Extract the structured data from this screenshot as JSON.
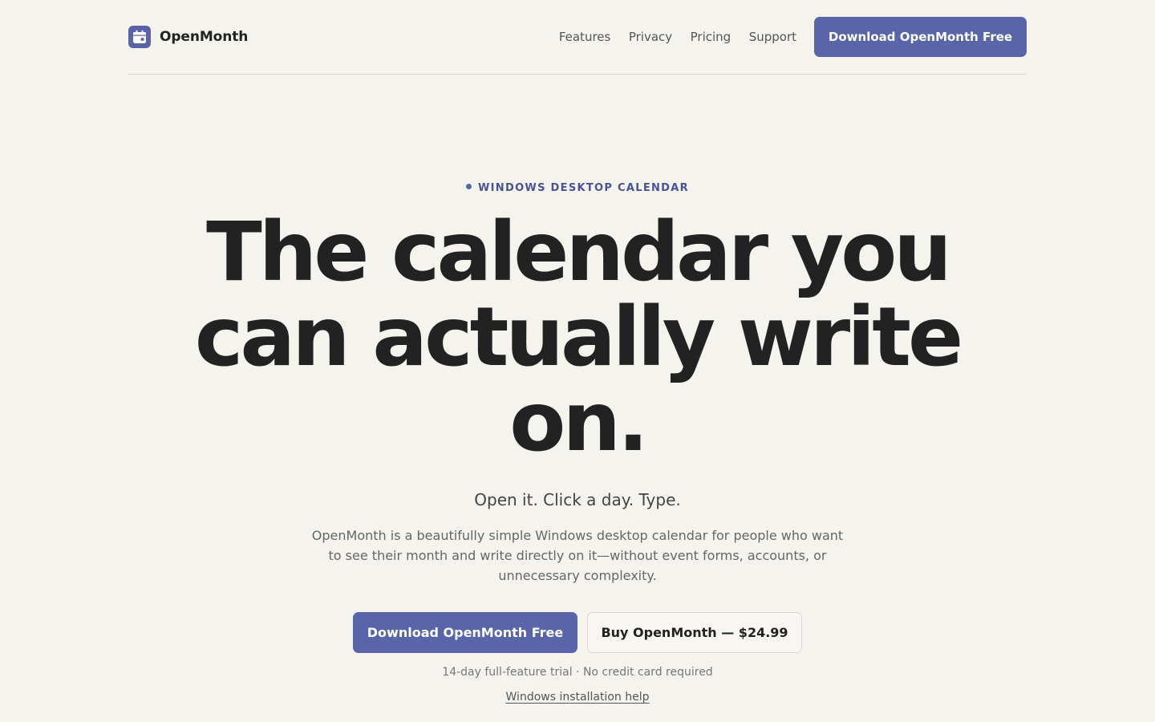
{
  "header": {
    "brand_name": "OpenMonth",
    "logo_icon": "calendar-icon",
    "nav": [
      {
        "label": "Features"
      },
      {
        "label": "Privacy"
      },
      {
        "label": "Pricing"
      },
      {
        "label": "Support"
      }
    ],
    "download_label": "Download OpenMonth Free"
  },
  "hero": {
    "eyebrow": "WINDOWS DESKTOP CALENDAR",
    "headline_line1": "The calendar you",
    "headline_line2": "can actually write",
    "headline_line3": "on.",
    "tagline": "Open it. Click a day. Type.",
    "description": "OpenMonth is a beautifully simple Windows desktop calendar for people who want to see their month and write directly on it—without event forms, accounts, or unnecessary complexity.",
    "primary_cta": "Download OpenMonth Free",
    "secondary_cta": "Buy OpenMonth — $24.99",
    "trial_note": "14-day full-feature trial · No credit card required",
    "help_link": "Windows installation help"
  },
  "colors": {
    "background": "#f5f3ee",
    "accent": "#5a64a8",
    "eyebrow": "#4a5296",
    "text": "#222222"
  }
}
